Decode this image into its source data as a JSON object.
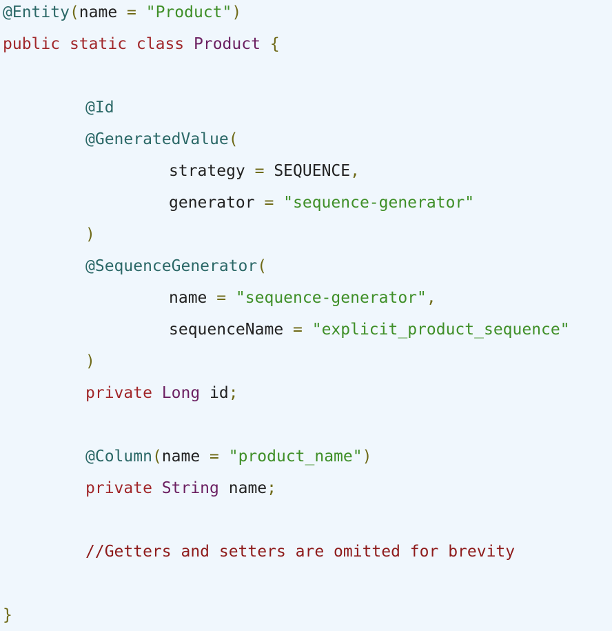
{
  "code": {
    "entity_annotation": "@Entity",
    "entity_name_key": "name",
    "entity_name_value": "\"Product\"",
    "kw_public": "public",
    "kw_static": "static",
    "kw_class": "class",
    "class_name": "Product",
    "id_annotation": "@Id",
    "generated_value_annotation": "@GeneratedValue",
    "strategy_key": "strategy",
    "strategy_value": "SEQUENCE",
    "generator_key": "generator",
    "generator_value": "\"sequence-generator\"",
    "sequence_generator_annotation": "@SequenceGenerator",
    "seq_name_key": "name",
    "seq_name_value": "\"sequence-generator\"",
    "sequence_name_key": "sequenceName",
    "sequence_name_value": "\"explicit_product_sequence\"",
    "kw_private": "private",
    "id_type": "Long",
    "id_field": "id",
    "column_annotation": "@Column",
    "column_name_key": "name",
    "column_name_value": "\"product_name\"",
    "name_type": "String",
    "name_field": "name",
    "comment": "//Getters and setters are omitted for brevity"
  }
}
